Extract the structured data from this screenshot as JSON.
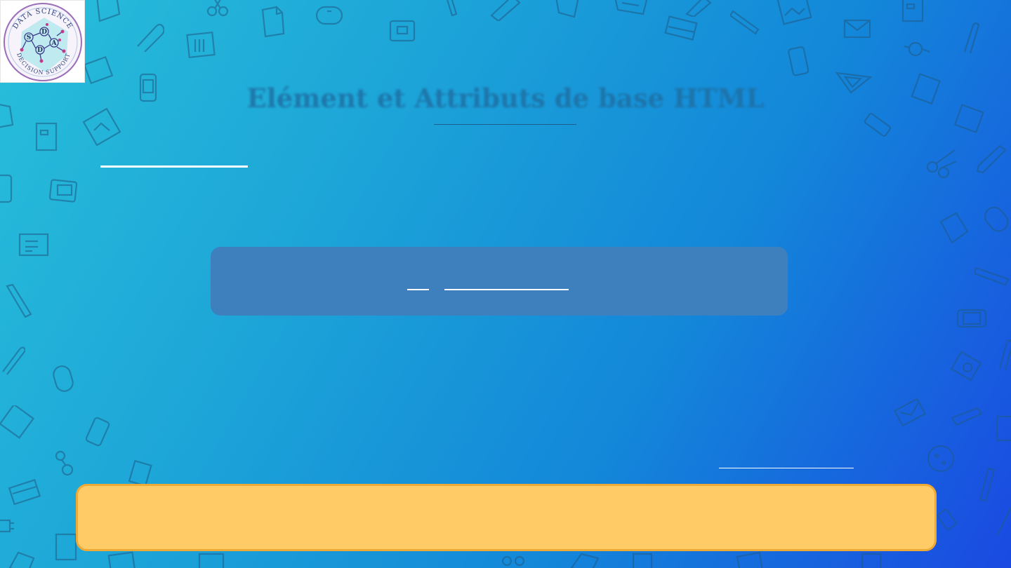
{
  "slide": {
    "title": "Elément et Attributs de base HTML"
  },
  "logo": {
    "top_text": "DATA SCIENCE",
    "bottom_text": "DECISION SUPPORT",
    "letters": [
      "S",
      "D",
      "D",
      "A"
    ]
  },
  "colors": {
    "background_start": "#28bfda",
    "background_end": "#1a49e2",
    "panel": "#3e80bd",
    "callout_fill": "#fecb67",
    "callout_border": "#eeaa36"
  }
}
